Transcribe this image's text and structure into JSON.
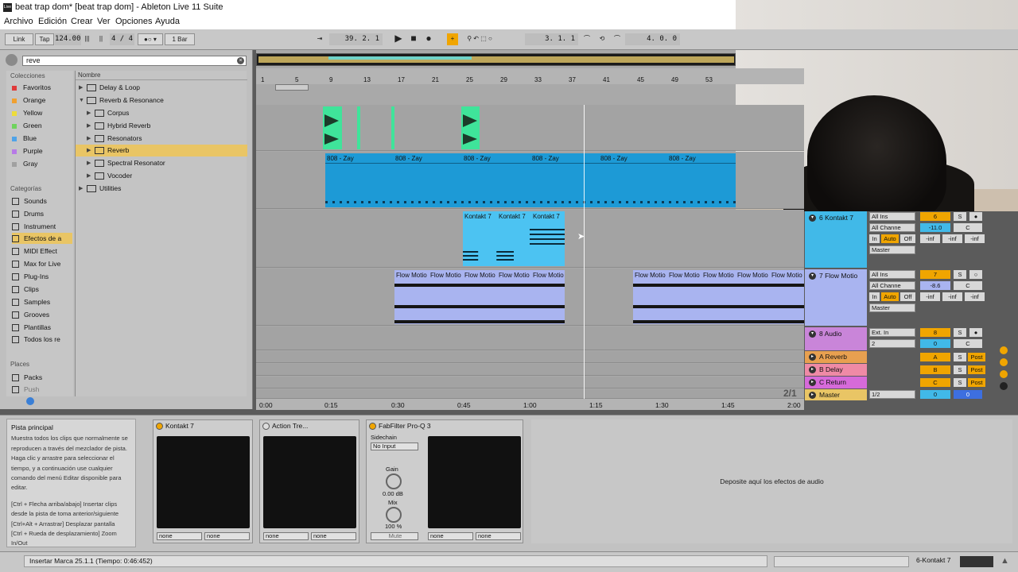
{
  "window": {
    "title": "beat trap dom*  [beat trap dom] - Ableton Live 11 Suite",
    "menu": [
      "Archivo",
      "Edición",
      "Crear",
      "Ver",
      "Opciones",
      "Ayuda"
    ]
  },
  "transport": {
    "link": "Link",
    "tap": "Tap",
    "tempo": "124.00",
    "signature": "4 / 4",
    "metro": "1 Bar",
    "position": "39.  2.  1",
    "loop_start": "3.  1.  1",
    "loop_length": "4.  0.  0"
  },
  "browser": {
    "search": "reve",
    "collections_header": "Colecciones",
    "collections": [
      {
        "label": "Favoritos",
        "color": "#e03a3a"
      },
      {
        "label": "Orange",
        "color": "#f0a030"
      },
      {
        "label": "Yellow",
        "color": "#eddc3a"
      },
      {
        "label": "Green",
        "color": "#6fd35d"
      },
      {
        "label": "Blue",
        "color": "#4fa3e8"
      },
      {
        "label": "Purple",
        "color": "#b77ae6"
      },
      {
        "label": "Gray",
        "color": "#a0a0a0"
      }
    ],
    "categories_header": "Categorías",
    "categories": [
      "Sounds",
      "Drums",
      "Instrument",
      "Efectos de a",
      "MIDI Effect",
      "Max for Live",
      "Plug-Ins",
      "Clips",
      "Samples",
      "Grooves",
      "Plantillas",
      "Todos los re"
    ],
    "selected_category": "Efectos de a",
    "places_header": "Places",
    "places": [
      "Packs",
      "Push"
    ],
    "name_header": "Nombre",
    "files": [
      {
        "label": "Delay & Loop",
        "level": 0,
        "open": false
      },
      {
        "label": "Reverb & Resonance",
        "level": 0,
        "open": true
      },
      {
        "label": "Corpus",
        "level": 1,
        "open": false
      },
      {
        "label": "Hybrid Reverb",
        "level": 1,
        "open": false
      },
      {
        "label": "Resonators",
        "level": 1,
        "open": false
      },
      {
        "label": "Reverb",
        "level": 1,
        "open": false,
        "selected": true
      },
      {
        "label": "Spectral Resonator",
        "level": 1,
        "open": false
      },
      {
        "label": "Vocoder",
        "level": 1,
        "open": false
      },
      {
        "label": "Utilities",
        "level": 0,
        "open": false
      }
    ]
  },
  "ruler": [
    "1",
    "5",
    "9",
    "13",
    "17",
    "21",
    "25",
    "29",
    "33",
    "37",
    "41",
    "45",
    "49",
    "53"
  ],
  "timeline": [
    "0:00",
    "0:15",
    "0:30",
    "0:45",
    "1:00",
    "1:15",
    "1:30",
    "1:45",
    "2:00"
  ],
  "zoom_indicator": "2/1",
  "clips": {
    "bass": "808 - Zay",
    "kontakt": "Kontakt 7",
    "flow": "Flow Motio"
  },
  "tracks": [
    {
      "name": "6 Kontakt 7",
      "color": "#41b9e8",
      "input": "All Ins",
      "channel": "All Channe",
      "num": "6",
      "vol": "-11.0",
      "pan": "C",
      "out": "Master"
    },
    {
      "name": "7 Flow Motio",
      "color": "#a9b4f0",
      "input": "All Ins",
      "channel": "All Channe",
      "num": "7",
      "vol": "-8.6",
      "pan": "C",
      "out": "Master"
    },
    {
      "name": "8 Audio",
      "color": "#c985d9",
      "input": "Ext. In",
      "channel": "2",
      "num": "8",
      "vol": "0",
      "pan": "C"
    }
  ],
  "routing": {
    "in": "In",
    "auto": "Auto",
    "off": "Off",
    "inf": "-inf",
    "solo": "S"
  },
  "returns": [
    {
      "name": "A Reverb",
      "color": "#e8a050",
      "letter": "A",
      "send": "Post"
    },
    {
      "name": "B Delay",
      "color": "#ef8aa6",
      "letter": "B",
      "send": "Post"
    },
    {
      "name": "C Return",
      "color": "#d66ad9",
      "letter": "C",
      "send": "Post"
    }
  ],
  "master": {
    "name": "Master",
    "color": "#e9c565",
    "cue": "1/2",
    "vol": "0",
    "pan": "0"
  },
  "info": {
    "title": "Pista principal",
    "body": "Muestra todos los clips que normalmente se reproducen a través del mezclador de pista. Haga clic y arrastre para seleccionar el tiempo, y a continuación use cualquier comando del menú Editar disponible para editar.",
    "tip1": "[Ctrl + Flecha arriba/abajo] Insertar clips desde la pista de toma anterior/siguiente",
    "tip2": "[Ctrl+Alt + Arrastrar] Desplazar pantalla",
    "tip3": "[Ctrl + Rueda de desplazamiento] Zoom In/Out"
  },
  "devices": {
    "kontakt": "Kontakt 7",
    "action": "Action Tre...",
    "fabfilter": "FabFilter Pro-Q 3",
    "sidechain": "Sidechain",
    "no_input": "No Input",
    "gain": "Gain",
    "gain_val": "0.00 dB",
    "mix": "Mix",
    "mix_val": "100 %",
    "mute": "Mute",
    "none": "none",
    "drop": "Deposite aquí los efectos de audio"
  },
  "status": {
    "message": "Insertar Marca 25.1.1 (Tiempo: 0:46:452)",
    "track": "6-Kontakt 7"
  }
}
